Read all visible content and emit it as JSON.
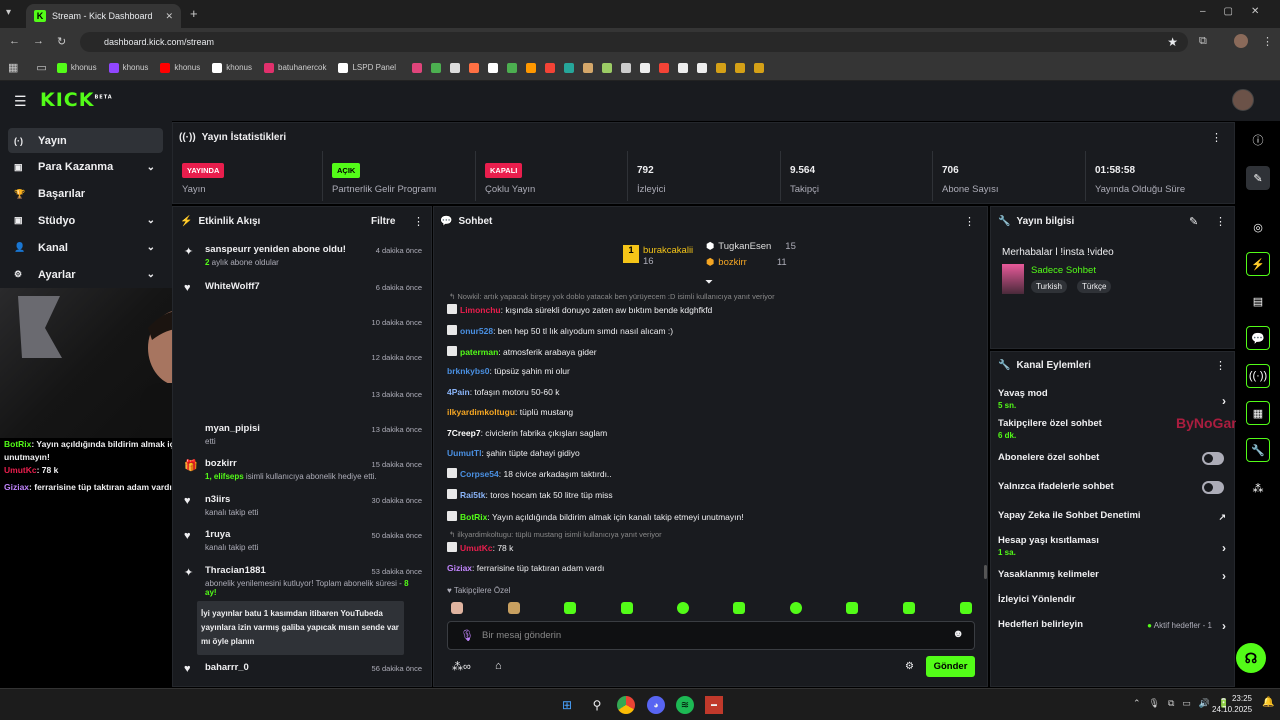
{
  "browser": {
    "tab_title": "Stream - Kick Dashboard",
    "url": "dashboard.kick.com/stream",
    "bookmarks": [
      {
        "label": "khonus",
        "color": "#53fc18"
      },
      {
        "label": "khonus",
        "color": "#9146ff"
      },
      {
        "label": "khonus",
        "color": "#ff0000"
      },
      {
        "label": "khonus",
        "color": "#ffffff"
      },
      {
        "label": "batuhanercok",
        "color": "#e1306c"
      },
      {
        "label": "LSPD Panel",
        "color": "#ffffff"
      }
    ]
  },
  "app": {
    "logo": "KICK",
    "beta": "BETA"
  },
  "sidebar": {
    "items": [
      {
        "label": "Yayın",
        "icon": "broadcast-icon",
        "chevron": false
      },
      {
        "label": "Para Kazanma",
        "icon": "money-icon",
        "chevron": true
      },
      {
        "label": "Başarılar",
        "icon": "trophy-icon",
        "chevron": false
      },
      {
        "label": "Stüdyo",
        "icon": "studio-icon",
        "chevron": true
      },
      {
        "label": "Kanal",
        "icon": "user-icon",
        "chevron": true
      },
      {
        "label": "Ayarlar",
        "icon": "gear-icon",
        "chevron": true
      }
    ]
  },
  "stats": {
    "title": "Yayın İstatistikleri",
    "items": [
      {
        "tag": "YAYINDA",
        "tag_color": "#e91e4d",
        "label": "Yayın"
      },
      {
        "tag": "AÇIK",
        "tag_color": "#53fc18",
        "label": "Partnerlik Gelir Programı"
      },
      {
        "tag": "KAPALI",
        "tag_color": "#e91e4d",
        "label": "Çoklu Yayın"
      },
      {
        "value": "792",
        "label": "İzleyici"
      },
      {
        "value": "9.564",
        "label": "Takipçi"
      },
      {
        "value": "706",
        "label": "Abone Sayısı"
      },
      {
        "value": "01:58:58",
        "label": "Yayında Olduğu Süre"
      }
    ]
  },
  "activity": {
    "title": "Etkinlik Akışı",
    "filter": "Filtre",
    "events": [
      {
        "name": "sanspeurr yeniden abone oldu!",
        "sub_hl": "2",
        "sub": " aylık abone oldular",
        "time": "4 dakika önce",
        "icon": "sparkle-icon"
      },
      {
        "name": "WhiteWolff7",
        "sub": "",
        "time": "6 dakika önce",
        "icon": "heart-icon"
      },
      {
        "name": "",
        "sub": "",
        "time": "10 dakika önce",
        "icon": ""
      },
      {
        "name": "",
        "sub": "",
        "time": "12 dakika önce",
        "icon": ""
      },
      {
        "name": "",
        "sub": "",
        "time": "13 dakika önce",
        "icon": ""
      },
      {
        "name": "myan_pipisi",
        "sub": "etti",
        "time": "13 dakika önce",
        "icon": ""
      },
      {
        "name": "bozkirr",
        "sub_hl": "1, elifseps",
        "sub": " isimli kullanıcıya abonelik hediye etti.",
        "time": "15 dakika önce",
        "icon": "gift-icon"
      },
      {
        "name": "n3iirs",
        "sub": "kanalı takip etti",
        "time": "30 dakika önce",
        "icon": "heart-icon"
      },
      {
        "name": "1ruya",
        "sub": "kanalı takip etti",
        "time": "50 dakika önce",
        "icon": "heart-icon"
      },
      {
        "name": "Thracian1881",
        "sub": "abonelik yenilemesini kutluyor! Toplam abonelik süresi - ",
        "sub_hl2": "8 ay!",
        "time": "53 dakika önce",
        "icon": "sparkle-icon",
        "quote": "İyi yayınlar batu 1 kasımdan itibaren YouTubeda yayınlara izin varmış galiba yapıcak mısın sende var mı öyle planın"
      },
      {
        "name": "baharrr_0",
        "sub": "",
        "time": "56 dakika önce",
        "icon": "heart-icon"
      }
    ]
  },
  "chat": {
    "title": "Sohbet",
    "top": [
      {
        "name": "burakcakalii",
        "count": "16",
        "color": "#f5c518"
      },
      {
        "name": "TugkanEsen",
        "count": "15",
        "color": "#fff"
      },
      {
        "name": "bozkirr",
        "count": "11",
        "color": "#f5a623"
      }
    ],
    "messages": [
      {
        "reply": "Nowkil: artık yapacak birşey yok doblo yatacak ben yürüyecem :D isimli kullanıcıya yanıt veriyor"
      },
      {
        "user": "Limonchu",
        "color": "#e91e4d",
        "text": ": kışında sürekli donuyo zaten aw bıktım bende kdghfkfd",
        "badge": true
      },
      {
        "user": "onur528",
        "color": "#4a90e2",
        "text": ": ben hep 50 tl lık alıyodum sımdı nasıl alıcam :)",
        "badge": true
      },
      {
        "user": "paterman",
        "color": "#53fc18",
        "text": ": atmosferik arabaya gider",
        "badge": true
      },
      {
        "user": "brknkybs0",
        "color": "#4a90e2",
        "text": ": tüpsüz şahin mi olur"
      },
      {
        "user": "4Pain",
        "color": "#8ab4f8",
        "text": ": tofaşın motoru 50-60 k"
      },
      {
        "user": "ilkyardimkoltugu",
        "color": "#f5a623",
        "text": ": tüplü mustang"
      },
      {
        "user": "7Creep7",
        "color": "#fff",
        "text": ": civiclerin fabrika çıkışları saglam"
      },
      {
        "user": "UumutTl",
        "color": "#4a90e2",
        "text": ": şahin tüpte dahayi gidiyo"
      },
      {
        "user": "Corpse54",
        "color": "#4a90e2",
        "text": ": 18 civice arkadaşım taktırdı..",
        "badge": true
      },
      {
        "user": "Rai5tk",
        "color": "#8ab4f8",
        "text": ": toros hocam tak 50 litre tüp miss",
        "badge": true
      },
      {
        "user": "BotRix",
        "color": "#53fc18",
        "text": ": Yayın açıldığında bildirim almak için kanalı takip etmeyi unutmayın!",
        "badge": true
      },
      {
        "reply": "ilkyardimkoltugu: tüplü mustang isimli kullanıcıya yanıt veriyor"
      },
      {
        "user": "UmutKc",
        "color": "#e91e4d",
        "text": ": 78 k",
        "badge": true
      },
      {
        "user": "Giziax",
        "color": "#c084fc",
        "text": ": ferrarisine tüp taktıran adam vardı"
      }
    ],
    "followers_only": "Takipçilere Özel",
    "placeholder": "Bir mesaj gönderin",
    "send": "Gönder"
  },
  "overlay": {
    "lines": [
      {
        "user": "BotRix",
        "color": "#53fc18",
        "text": ": Yayın açıldığında bildirim almak için kanalı takip etmeyi unutmayın!"
      },
      {
        "user": "UmutKc",
        "color": "#e91e4d",
        "text": ": 78 k"
      },
      {
        "user": "Giziax",
        "color": "#c084fc",
        "text": ": ferrarisine tüp taktıran adam vardı"
      }
    ]
  },
  "streaminfo": {
    "title": "Yayın bilgisi",
    "stream_title": "Merhabalar l !insta !video",
    "category": "Sadece Sohbet",
    "tags": [
      "Turkish",
      "Türkçe"
    ]
  },
  "actions": {
    "title": "Kanal Eylemleri",
    "items": [
      {
        "label": "Yavaş mod",
        "sub": "5 sn.",
        "type": "arrow"
      },
      {
        "label": "Takipçilere özel sohbet",
        "sub": "6 dk.",
        "type": "none"
      },
      {
        "label": "Abonelere özel sohbet",
        "type": "toggle"
      },
      {
        "label": "Yalnızca ifadelerle sohbet",
        "type": "toggle"
      },
      {
        "label": "Yapay Zeka ile Sohbet Denetimi",
        "type": "ext"
      },
      {
        "label": "Hesap yaşı kısıtlaması",
        "sub": "1 sa.",
        "type": "arrow"
      },
      {
        "label": "Yasaklanmış kelimeler",
        "type": "arrow"
      },
      {
        "label": "İzleyici Yönlendir",
        "type": "none"
      },
      {
        "label": "Hedefleri belirleyin",
        "extra": "Aktif hedefler - 1",
        "type": "arrow"
      }
    ]
  },
  "taskbar": {
    "time": "23:25",
    "date": "24.10.2025"
  }
}
